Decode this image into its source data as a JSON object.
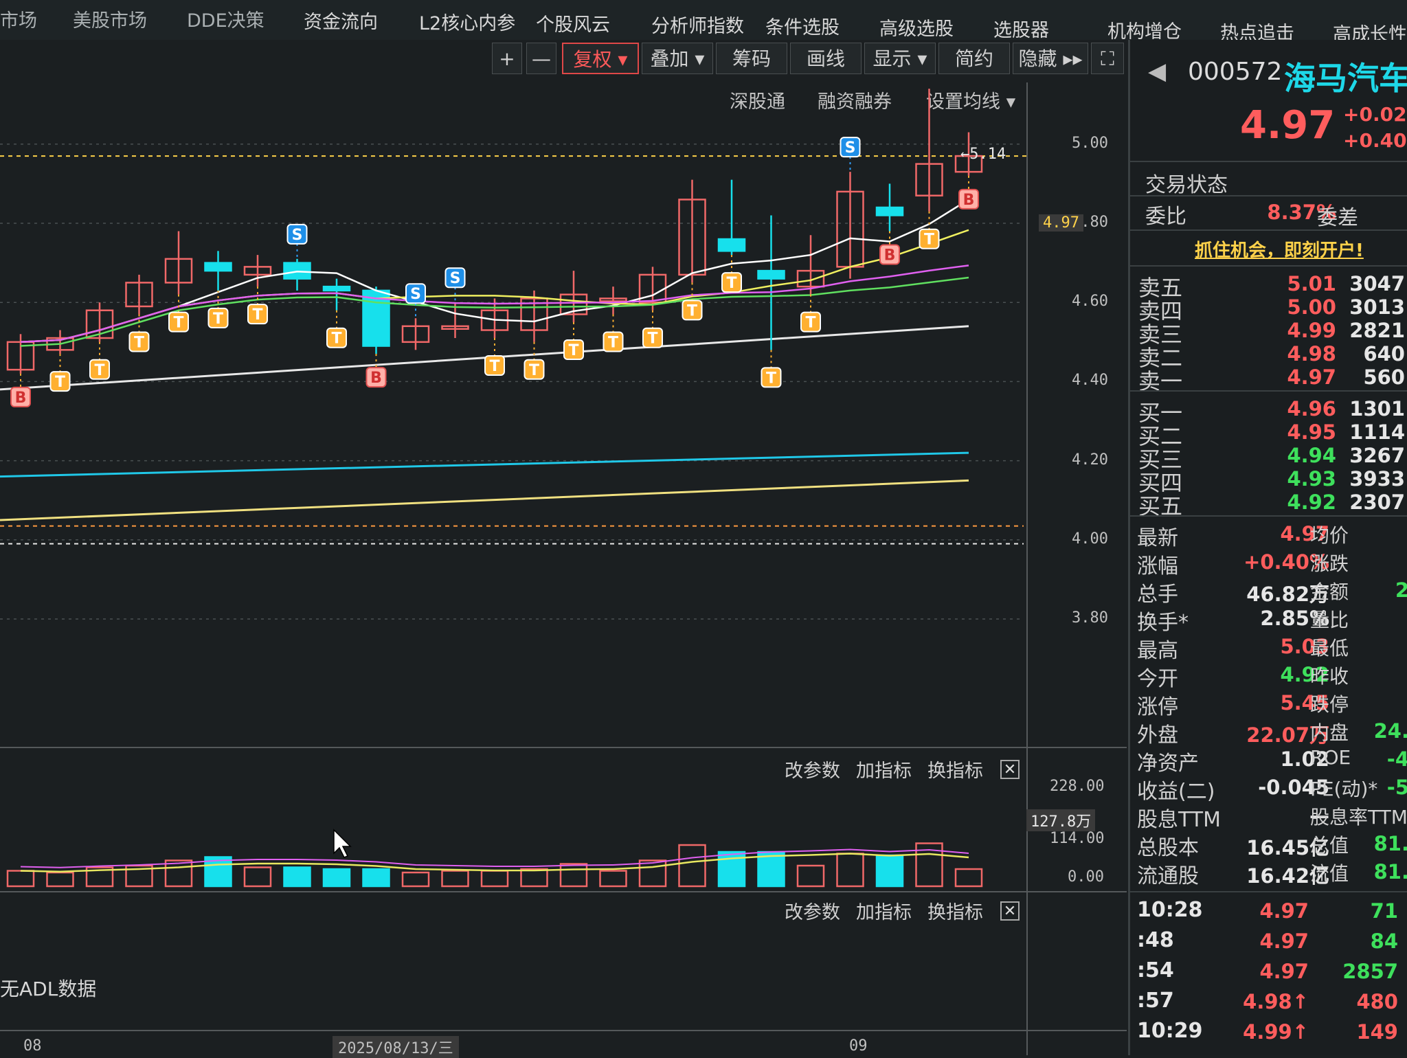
{
  "topnav": [
    "市场",
    "美股市场",
    "DDE决策",
    "资金流向",
    "L2核心内参",
    "个股风云",
    "分析师指数",
    "条件选股",
    "高级选股",
    "选股器",
    "机构增仓",
    "热点追击",
    "高成长性"
  ],
  "toolbar": {
    "plus": "+",
    "minus": "—",
    "fuquan": "复权",
    "diejia": "叠加",
    "chouma": "筹码",
    "huaxian": "画线",
    "xianshi": "显示",
    "jianyue": "简约",
    "yincang": "隐藏 ▸▸",
    "fullscreen": "⛶"
  },
  "subbar": {
    "shengutong": "深股通",
    "rongzi": "融资融券",
    "junxian": "设置均线"
  },
  "chart": {
    "y_ticks": [
      "5.00",
      "4.80",
      "4.60",
      "4.40",
      "4.20",
      "4.00",
      "3.80"
    ],
    "current_price_tag": "4.97",
    "high_annotation": "5.14",
    "x_labels": [
      "08",
      "2025/08/13/三",
      "09"
    ],
    "colors": {
      "up": "#f06868",
      "down": "#17e0ec",
      "ma5": "#ffffff",
      "ma10": "#f0f060",
      "ma20": "#e060f0",
      "ma30": "#60e060",
      "ma60": "#e8e8e8",
      "ma120": "#20c8e8",
      "ma250": "#f0e080"
    }
  },
  "chart_data": {
    "type": "candlestick",
    "symbol": "000572",
    "ylim": [
      3.7,
      5.2
    ],
    "candles": [
      {
        "o": 4.43,
        "c": 4.5,
        "h": 4.52,
        "l": 4.42
      },
      {
        "o": 4.48,
        "c": 4.51,
        "h": 4.53,
        "l": 4.47
      },
      {
        "o": 4.51,
        "c": 4.58,
        "h": 4.6,
        "l": 4.5
      },
      {
        "o": 4.59,
        "c": 4.65,
        "h": 4.67,
        "l": 4.57
      },
      {
        "o": 4.65,
        "c": 4.71,
        "h": 4.78,
        "l": 4.62
      },
      {
        "o": 4.7,
        "c": 4.68,
        "h": 4.73,
        "l": 4.63
      },
      {
        "o": 4.67,
        "c": 4.69,
        "h": 4.72,
        "l": 4.64
      },
      {
        "o": 4.7,
        "c": 4.66,
        "h": 4.71,
        "l": 4.63
      },
      {
        "o": 4.64,
        "c": 4.63,
        "h": 4.66,
        "l": 4.58
      },
      {
        "o": 4.63,
        "c": 4.49,
        "h": 4.64,
        "l": 4.47
      },
      {
        "o": 4.5,
        "c": 4.54,
        "h": 4.56,
        "l": 4.48
      },
      {
        "o": 4.54,
        "c": 4.54,
        "h": 4.6,
        "l": 4.51
      },
      {
        "o": 4.53,
        "c": 4.58,
        "h": 4.61,
        "l": 4.51
      },
      {
        "o": 4.53,
        "c": 4.61,
        "h": 4.63,
        "l": 4.5
      },
      {
        "o": 4.57,
        "c": 4.62,
        "h": 4.68,
        "l": 4.55
      },
      {
        "o": 4.61,
        "c": 4.61,
        "h": 4.64,
        "l": 4.57
      },
      {
        "o": 4.6,
        "c": 4.67,
        "h": 4.69,
        "l": 4.58
      },
      {
        "o": 4.67,
        "c": 4.86,
        "h": 4.91,
        "l": 4.65
      },
      {
        "o": 4.76,
        "c": 4.73,
        "h": 4.91,
        "l": 4.72
      },
      {
        "o": 4.68,
        "c": 4.66,
        "h": 4.82,
        "l": 4.48
      },
      {
        "o": 4.64,
        "c": 4.68,
        "h": 4.77,
        "l": 4.62
      },
      {
        "o": 4.69,
        "c": 4.88,
        "h": 4.93,
        "l": 4.66
      },
      {
        "o": 4.84,
        "c": 4.82,
        "h": 4.9,
        "l": 4.78
      },
      {
        "o": 4.87,
        "c": 4.95,
        "h": 5.14,
        "l": 4.83
      },
      {
        "o": 4.93,
        "c": 4.97,
        "h": 5.03,
        "l": 4.92
      }
    ],
    "signals": [
      "B",
      "T",
      "T",
      "T",
      "T",
      "T",
      "T",
      "S",
      "T",
      "B",
      "S",
      "S",
      "T",
      "T",
      "T",
      "T",
      "T",
      "T",
      "T",
      "T",
      "T",
      "S",
      "B",
      "T",
      "B"
    ],
    "volume": {
      "labels": [
        "228.00",
        "114.00",
        "0.00"
      ],
      "current": "127.8万"
    }
  },
  "indicator_menu": {
    "gaicanshu": "改参数",
    "jiazhibiao": "加指标",
    "huanzhibiao": "换指标",
    "close": "✕"
  },
  "adl_note": "无ADL数据",
  "quote": {
    "code": "000572",
    "name": "海马汽车",
    "price": "4.97",
    "change": "+0.02",
    "change_pct": "+0.40%",
    "trade_status_label": "交易状态",
    "weibi_label": "委比",
    "weibi_value": "8.37%",
    "weicha_label": "委差",
    "promo": "抓住机会，即刻开户!",
    "asks": [
      {
        "label": "卖五",
        "price": "5.01",
        "vol": "3047"
      },
      {
        "label": "卖四",
        "price": "5.00",
        "vol": "3013"
      },
      {
        "label": "卖三",
        "price": "4.99",
        "vol": "2821"
      },
      {
        "label": "卖二",
        "price": "4.98",
        "vol": "640"
      },
      {
        "label": "卖一",
        "price": "4.97",
        "vol": "560"
      }
    ],
    "bids": [
      {
        "label": "买一",
        "price": "4.96",
        "vol": "1301"
      },
      {
        "label": "买二",
        "price": "4.95",
        "vol": "1114"
      },
      {
        "label": "买三",
        "price": "4.94",
        "vol": "3267"
      },
      {
        "label": "买四",
        "price": "4.93",
        "vol": "3933"
      },
      {
        "label": "买五",
        "price": "4.92",
        "vol": "2307"
      }
    ],
    "stats": [
      {
        "l": "最新",
        "v": "4.97",
        "c": "red",
        "l2": "均价",
        "v2": ""
      },
      {
        "l": "涨幅",
        "v": "+0.40%",
        "c": "red",
        "l2": "涨跌",
        "v2": ""
      },
      {
        "l": "总手",
        "v": "46.82万",
        "c": "white",
        "l2": "金额",
        "v2": "2"
      },
      {
        "l": "换手*",
        "v": "2.85%",
        "c": "white",
        "l2": "量比",
        "v2": ""
      },
      {
        "l": "最高",
        "v": "5.03",
        "c": "red",
        "l2": "最低",
        "v2": ""
      },
      {
        "l": "今开",
        "v": "4.92",
        "c": "green",
        "l2": "昨收",
        "v2": ""
      },
      {
        "l": "涨停",
        "v": "5.45",
        "c": "red",
        "l2": "跌停",
        "v2": ""
      },
      {
        "l": "外盘",
        "v": "22.07万",
        "c": "red",
        "l2": "内盘",
        "v2": "24."
      },
      {
        "l": "净资产",
        "v": "1.02",
        "c": "white",
        "l2": "ROE",
        "v2": "-4"
      },
      {
        "l": "收益(二)",
        "v": "-0.045",
        "c": "white",
        "l2": "PE(动)*",
        "v2": "-5"
      },
      {
        "l": "股息TTM",
        "v": "—",
        "c": "white",
        "l2": "股息率TTM",
        "v2": ""
      },
      {
        "l": "总股本",
        "v": "16.45亿",
        "c": "white",
        "l2": "总值",
        "v2": "81."
      },
      {
        "l": "流通股",
        "v": "16.42亿",
        "c": "white",
        "l2": "流值",
        "v2": "81."
      }
    ],
    "ticks": [
      {
        "t": "10:28",
        "p": "4.97",
        "v": "71",
        "vc": "green"
      },
      {
        "t": ":48",
        "p": "4.97",
        "v": "84",
        "vc": "green"
      },
      {
        "t": ":54",
        "p": "4.97",
        "v": "2857",
        "vc": "green"
      },
      {
        "t": ":57",
        "p": "4.98↑",
        "v": "480",
        "vc": "red"
      },
      {
        "t": "10:29",
        "p": "4.99↑",
        "v": "149",
        "vc": "red"
      }
    ]
  }
}
